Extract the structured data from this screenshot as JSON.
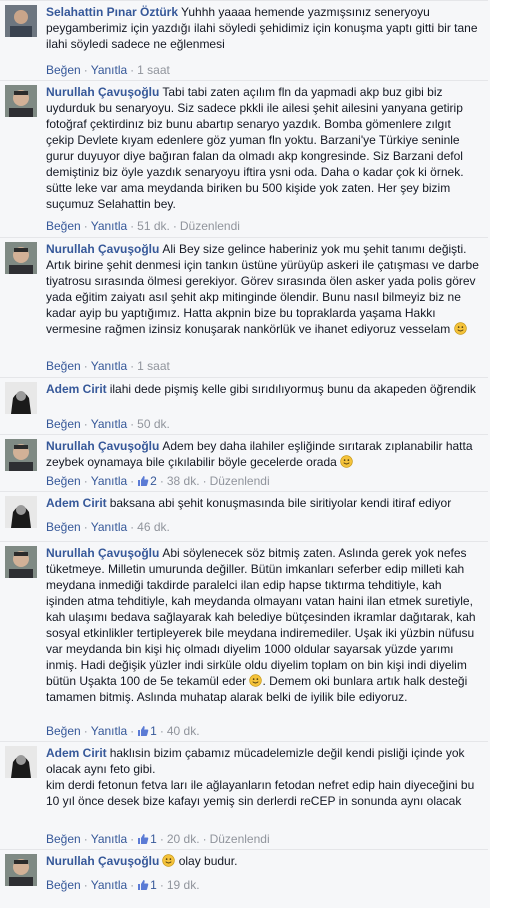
{
  "ui": {
    "like_label": "Beğen",
    "reply_label": "Yanıtla",
    "edited_label": "Düzenlendi",
    "separator": "·",
    "colors": {
      "link": "#365899",
      "meta": "#90949c",
      "background": "#f6f7f9",
      "text": "#141823"
    }
  },
  "comments": [
    {
      "author": "Selahattin Pınar Öztürk",
      "avatar": "person-photo-icon",
      "text": "Yuhhh yaaaa hemende yazmışsınız seneryoyu peygamberimiz için yazdığı ilahi söyledi şehidimiz için konuşma yaptı gitti bir tane ilahi söyledi sadece ne eğlenmesi",
      "time": "1 saat"
    },
    {
      "author": "Nurullah Çavuşoğlu",
      "avatar": "person-photo-icon",
      "text": "Tabi tabi zaten açılım fln da yapmadi akp buz gibi biz uydurduk bu senaryoyu. Siz sadece pkkli ile ailesi şehit ailesini yanyana getirip fotoğraf çektirdinız biz bunu abartıp senaryo yazdık. Bomba gömenlere zılgıt çekip Devlete kıyam edenlere göz yuman fln yoktu. Barzani'ye Türkiye seninle gurur duyuyor diye bağıran falan da olmadı akp kongresinde. Siz Barzani defol demiştiniz biz öyle yazdık senaryoyu iftira ysni oda. Daha o kadar çok ki örnek. sütte leke var ama meydanda biriken bu 500 kişide yok zaten. Her şey bizim suçumuz Selahattin bey.",
      "time": "51 dk.",
      "edited": "Düzenlendi"
    },
    {
      "author": "Nurullah Çavuşoğlu",
      "avatar": "person-photo-icon",
      "text": "Ali Bey size gelince haberiniz yok mu şehit tanımı değişti. Artık birine şehit denmesi için tankın üstüne yürüyüp askeri ile çatışması ve darbe tiyatrosu sırasında ölmesi gerekiyor. Görev sırasında ölen asker yada polis görev yada eğitim zaiyatı asıl şehit akp mitinginde ölendir. Bunu nasıl bilmeyiz biz ne kadar ayip bu yaptığımız. Hatta akpnin bize bu topraklarda yaşama Hakkı vermesine rağmen izinsiz konuşarak nankörlük ve ihanet ediyoruz vesselam",
      "emoji": true,
      "time": "1 saat"
    },
    {
      "author": "Adem Cirit",
      "avatar": "person-photo-icon",
      "text": "ilahi dede pişmiş kelle gibi sırıdılıyormuş bunu da akapeden öğrendik",
      "time": "50 dk."
    },
    {
      "author": "Nurullah Çavuşoğlu",
      "avatar": "person-photo-icon",
      "text": "Adem bey daha ilahiler eşliğinde sırıtarak zıplanabilir hatta zeybek oynamaya bile çıkılabilir böyle gecelerde orada",
      "emoji": true,
      "likes": "2",
      "time": "38 dk.",
      "edited": "Düzenlendi"
    },
    {
      "author": "Adem Cirit",
      "avatar": "person-photo-icon",
      "text": "baksana abi şehit konuşmasında bile siritiyolar kendi itiraf ediyor",
      "time": "46 dk."
    },
    {
      "author": "Nurullah Çavuşoğlu",
      "avatar": "person-photo-icon",
      "text": "Abi söylenecek söz bitmiş zaten. Aslında gerek yok nefes tüketmeye. Milletin umurunda değiller. Bütün imkanları seferber edip milleti kah meydana inmediği takdirde paralelci ilan edip hapse tıktırma tehditiyle, kah işinden atma tehditiyle, kah meydanda olmayanı vatan haini ilan etmek suretiyle, kah ulaşımı bedava sağlayarak kah belediye bütçesinden ikramlar dağıtarak, kah sosyal etkinlikler tertipleyerek bile meydana indiremediler. Uşak iki yüzbin nüfusu var meydanda bin kişi hiç olmadı diyelim 1000 oldular sayarsak yüzde yarımı inmiş. Hadi değişik yüzler indi sirküle oldu diyelim toplam on bin kişi indi diyelim bütün Uşakta 100 de 5e tekamül eder",
      "text2": ". Demem oki bunlara artık halk desteği tamamen bitmiş. Aslında muhatap alarak belki de iyilik bile ediyoruz.",
      "emoji": true,
      "likes": "1",
      "time": "40 dk."
    },
    {
      "author": "Adem Cirit",
      "avatar": "person-photo-icon",
      "text": "haklısin bizim çabamız mücadelemizle değil kendi pisliği içinde yok olacak aynı feto gibi.",
      "text_line2": "kim derdi fetonun fetva ları ile ağlayanların fetodan nefret edip hain diyeceğini bu 10 yıl önce desek bize kafayı yemiş sin derlerdi reCEP in sonunda aynı olacak",
      "likes": "1",
      "time": "20 dk.",
      "edited": "Düzenlendi"
    },
    {
      "author": "Nurullah Çavuşoğlu",
      "avatar": "person-photo-icon",
      "text": "olay budur.",
      "emoji_first": true,
      "likes": "1",
      "time": "19 dk."
    }
  ]
}
